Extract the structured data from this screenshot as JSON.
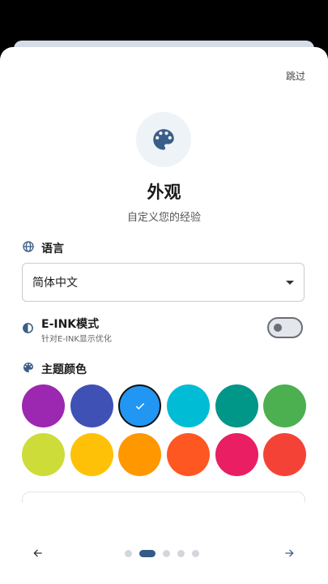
{
  "header": {
    "skip_label": "跳过"
  },
  "hero": {
    "icon": "palette-icon",
    "title": "外观",
    "subtitle": "自定义您的经验"
  },
  "language": {
    "icon": "globe-icon",
    "label": "语言",
    "selected": "简体中文"
  },
  "eink": {
    "icon": "contrast-icon",
    "title": "E-INK模式",
    "description": "针对E-INK显示优化",
    "enabled": false
  },
  "theme": {
    "icon": "palette-icon",
    "label": "主题颜色",
    "colors": [
      "#9c27b0",
      "#3f51b5",
      "#2196f3",
      "#00bcd4",
      "#009688",
      "#4caf50",
      "#cddc39",
      "#ffc107",
      "#ff9800",
      "#ff5722",
      "#e91e63",
      "#f44336"
    ],
    "selected_index": 2
  },
  "pager": {
    "page_count": 5,
    "current_page": 2
  },
  "colors": {
    "accent": "#355a86",
    "icon": "#3a5e87"
  }
}
